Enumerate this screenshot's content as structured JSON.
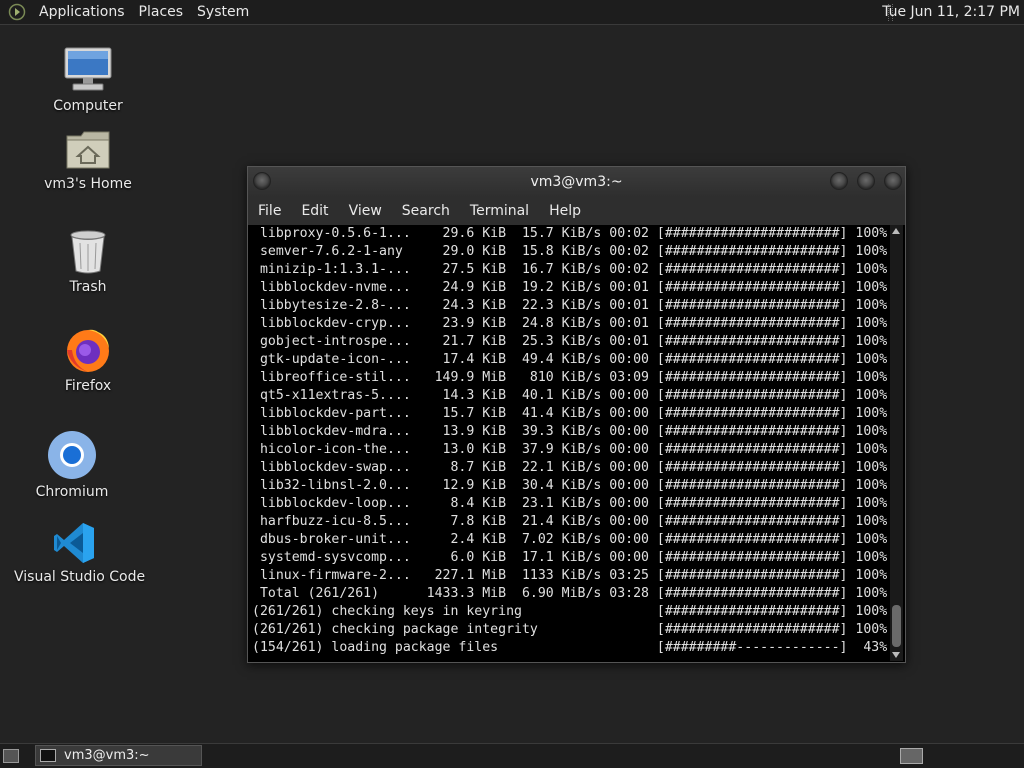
{
  "top_panel": {
    "menus": [
      "Applications",
      "Places",
      "System"
    ],
    "clock": "Tue Jun 11,  2:17 PM"
  },
  "desktop": {
    "icons": [
      {
        "label": "Computer",
        "icon": "computer-icon"
      },
      {
        "label": "vm3's Home",
        "icon": "home-folder-icon"
      },
      {
        "label": "Trash",
        "icon": "trash-icon"
      },
      {
        "label": "Firefox",
        "icon": "firefox-icon"
      },
      {
        "label": "Chromium",
        "icon": "chromium-icon"
      },
      {
        "label": "Visual Studio Code",
        "icon": "vscode-icon"
      }
    ]
  },
  "terminal": {
    "title": "vm3@vm3:~",
    "menu": [
      "File",
      "Edit",
      "View",
      "Search",
      "Terminal",
      "Help"
    ],
    "lines": [
      " libproxy-0.5.6-1...    29.6 KiB  15.7 KiB/s 00:02 [######################] 100%",
      " semver-7.6.2-1-any     29.0 KiB  15.8 KiB/s 00:02 [######################] 100%",
      " minizip-1:1.3.1-...    27.5 KiB  16.7 KiB/s 00:02 [######################] 100%",
      " libblockdev-nvme...    24.9 KiB  19.2 KiB/s 00:01 [######################] 100%",
      " libbytesize-2.8-...    24.3 KiB  22.3 KiB/s 00:01 [######################] 100%",
      " libblockdev-cryp...    23.9 KiB  24.8 KiB/s 00:01 [######################] 100%",
      " gobject-introspe...    21.7 KiB  25.3 KiB/s 00:01 [######################] 100%",
      " gtk-update-icon-...    17.4 KiB  49.4 KiB/s 00:00 [######################] 100%",
      " libreoffice-stil...   149.9 MiB   810 KiB/s 03:09 [######################] 100%",
      " qt5-x11extras-5....    14.3 KiB  40.1 KiB/s 00:00 [######################] 100%",
      " libblockdev-part...    15.7 KiB  41.4 KiB/s 00:00 [######################] 100%",
      " libblockdev-mdra...    13.9 KiB  39.3 KiB/s 00:00 [######################] 100%",
      " hicolor-icon-the...    13.0 KiB  37.9 KiB/s 00:00 [######################] 100%",
      " libblockdev-swap...     8.7 KiB  22.1 KiB/s 00:00 [######################] 100%",
      " lib32-libnsl-2.0...    12.9 KiB  30.4 KiB/s 00:00 [######################] 100%",
      " libblockdev-loop...     8.4 KiB  23.1 KiB/s 00:00 [######################] 100%",
      " harfbuzz-icu-8.5...     7.8 KiB  21.4 KiB/s 00:00 [######################] 100%",
      " dbus-broker-unit...     2.4 KiB  7.02 KiB/s 00:00 [######################] 100%",
      " systemd-sysvcomp...     6.0 KiB  17.1 KiB/s 00:00 [######################] 100%",
      " linux-firmware-2...   227.1 MiB  1133 KiB/s 03:25 [######################] 100%",
      " Total (261/261)      1433.3 MiB  6.90 MiB/s 03:28 [######################] 100%",
      "(261/261) checking keys in keyring                 [######################] 100%",
      "(261/261) checking package integrity               [######################] 100%",
      "(154/261) loading package files                    [#########-------------]  43%"
    ]
  },
  "taskbar": {
    "task_label": "vm3@vm3:~"
  }
}
